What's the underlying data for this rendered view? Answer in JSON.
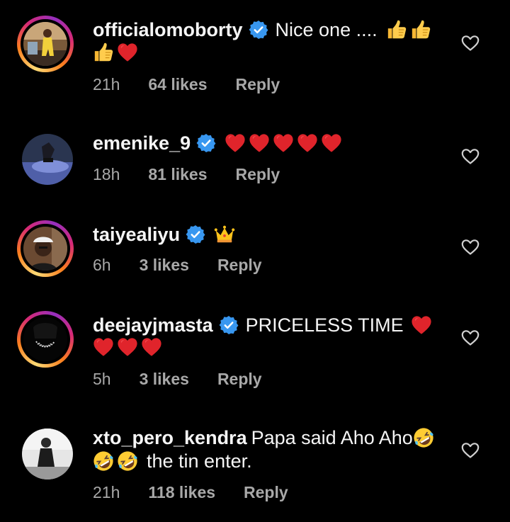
{
  "comments": [
    {
      "username": "officialomoborty",
      "text": "Nice one ....",
      "emoji_line1": [
        "thumbs-up",
        "thumbs-up"
      ],
      "emoji_line2": [
        "thumbs-up",
        "red-heart"
      ],
      "time": "21h",
      "likes": "64 likes",
      "reply": "Reply"
    },
    {
      "username": "emenike_9",
      "emoji_line1": [
        "red-heart",
        "red-heart",
        "red-heart",
        "red-heart",
        "red-heart"
      ],
      "time": "18h",
      "likes": "81 likes",
      "reply": "Reply"
    },
    {
      "username": "taiyealiyu",
      "emoji_line1": [
        "crown"
      ],
      "time": "6h",
      "likes": "3 likes",
      "reply": "Reply"
    },
    {
      "username": "deejayjmasta",
      "text": "PRICELESS TIME",
      "emoji_line1": [
        "red-heart"
      ],
      "emoji_line2": [
        "red-heart",
        "red-heart",
        "red-heart"
      ],
      "time": "5h",
      "likes": "3 likes",
      "reply": "Reply"
    },
    {
      "username": "xto_pero_kendra",
      "text": "Papa said Aho Aho",
      "emoji_line1": [
        "rolling-laughing"
      ],
      "emoji_line2": [
        "rolling-laughing",
        "rolling-laughing"
      ],
      "text_line2": "the tin enter.",
      "time": "21h",
      "likes": "118 likes",
      "reply": "Reply"
    }
  ],
  "colors": {
    "background": "#000000",
    "text": "#f5f5f5",
    "meta": "#a8a8a8",
    "verified": "#3897f0",
    "heart": "#ed1c24"
  }
}
